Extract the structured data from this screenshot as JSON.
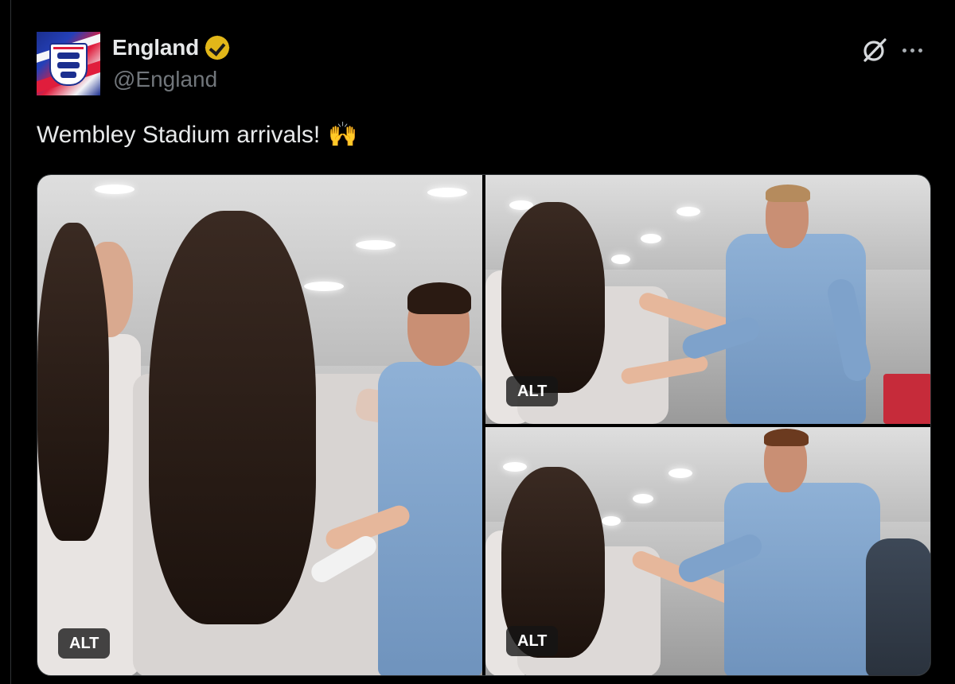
{
  "account": {
    "display_name": "England",
    "handle": "@England",
    "verified_color": "#e2b719"
  },
  "icons": {
    "grok": "grok-icon",
    "more": "more-options-icon",
    "verified": "verified-badge-icon"
  },
  "tweet": {
    "text": "Wembley Stadium arrivals!",
    "emoji": "🙌"
  },
  "media": {
    "photos": [
      {
        "alt_label": "ALT"
      },
      {
        "alt_label": "ALT"
      },
      {
        "alt_label": "ALT"
      }
    ]
  },
  "colors": {
    "background": "#000000",
    "text": "#e7e9ea",
    "secondary_text": "#71767b",
    "tracksuit": "#8fb1d6"
  }
}
